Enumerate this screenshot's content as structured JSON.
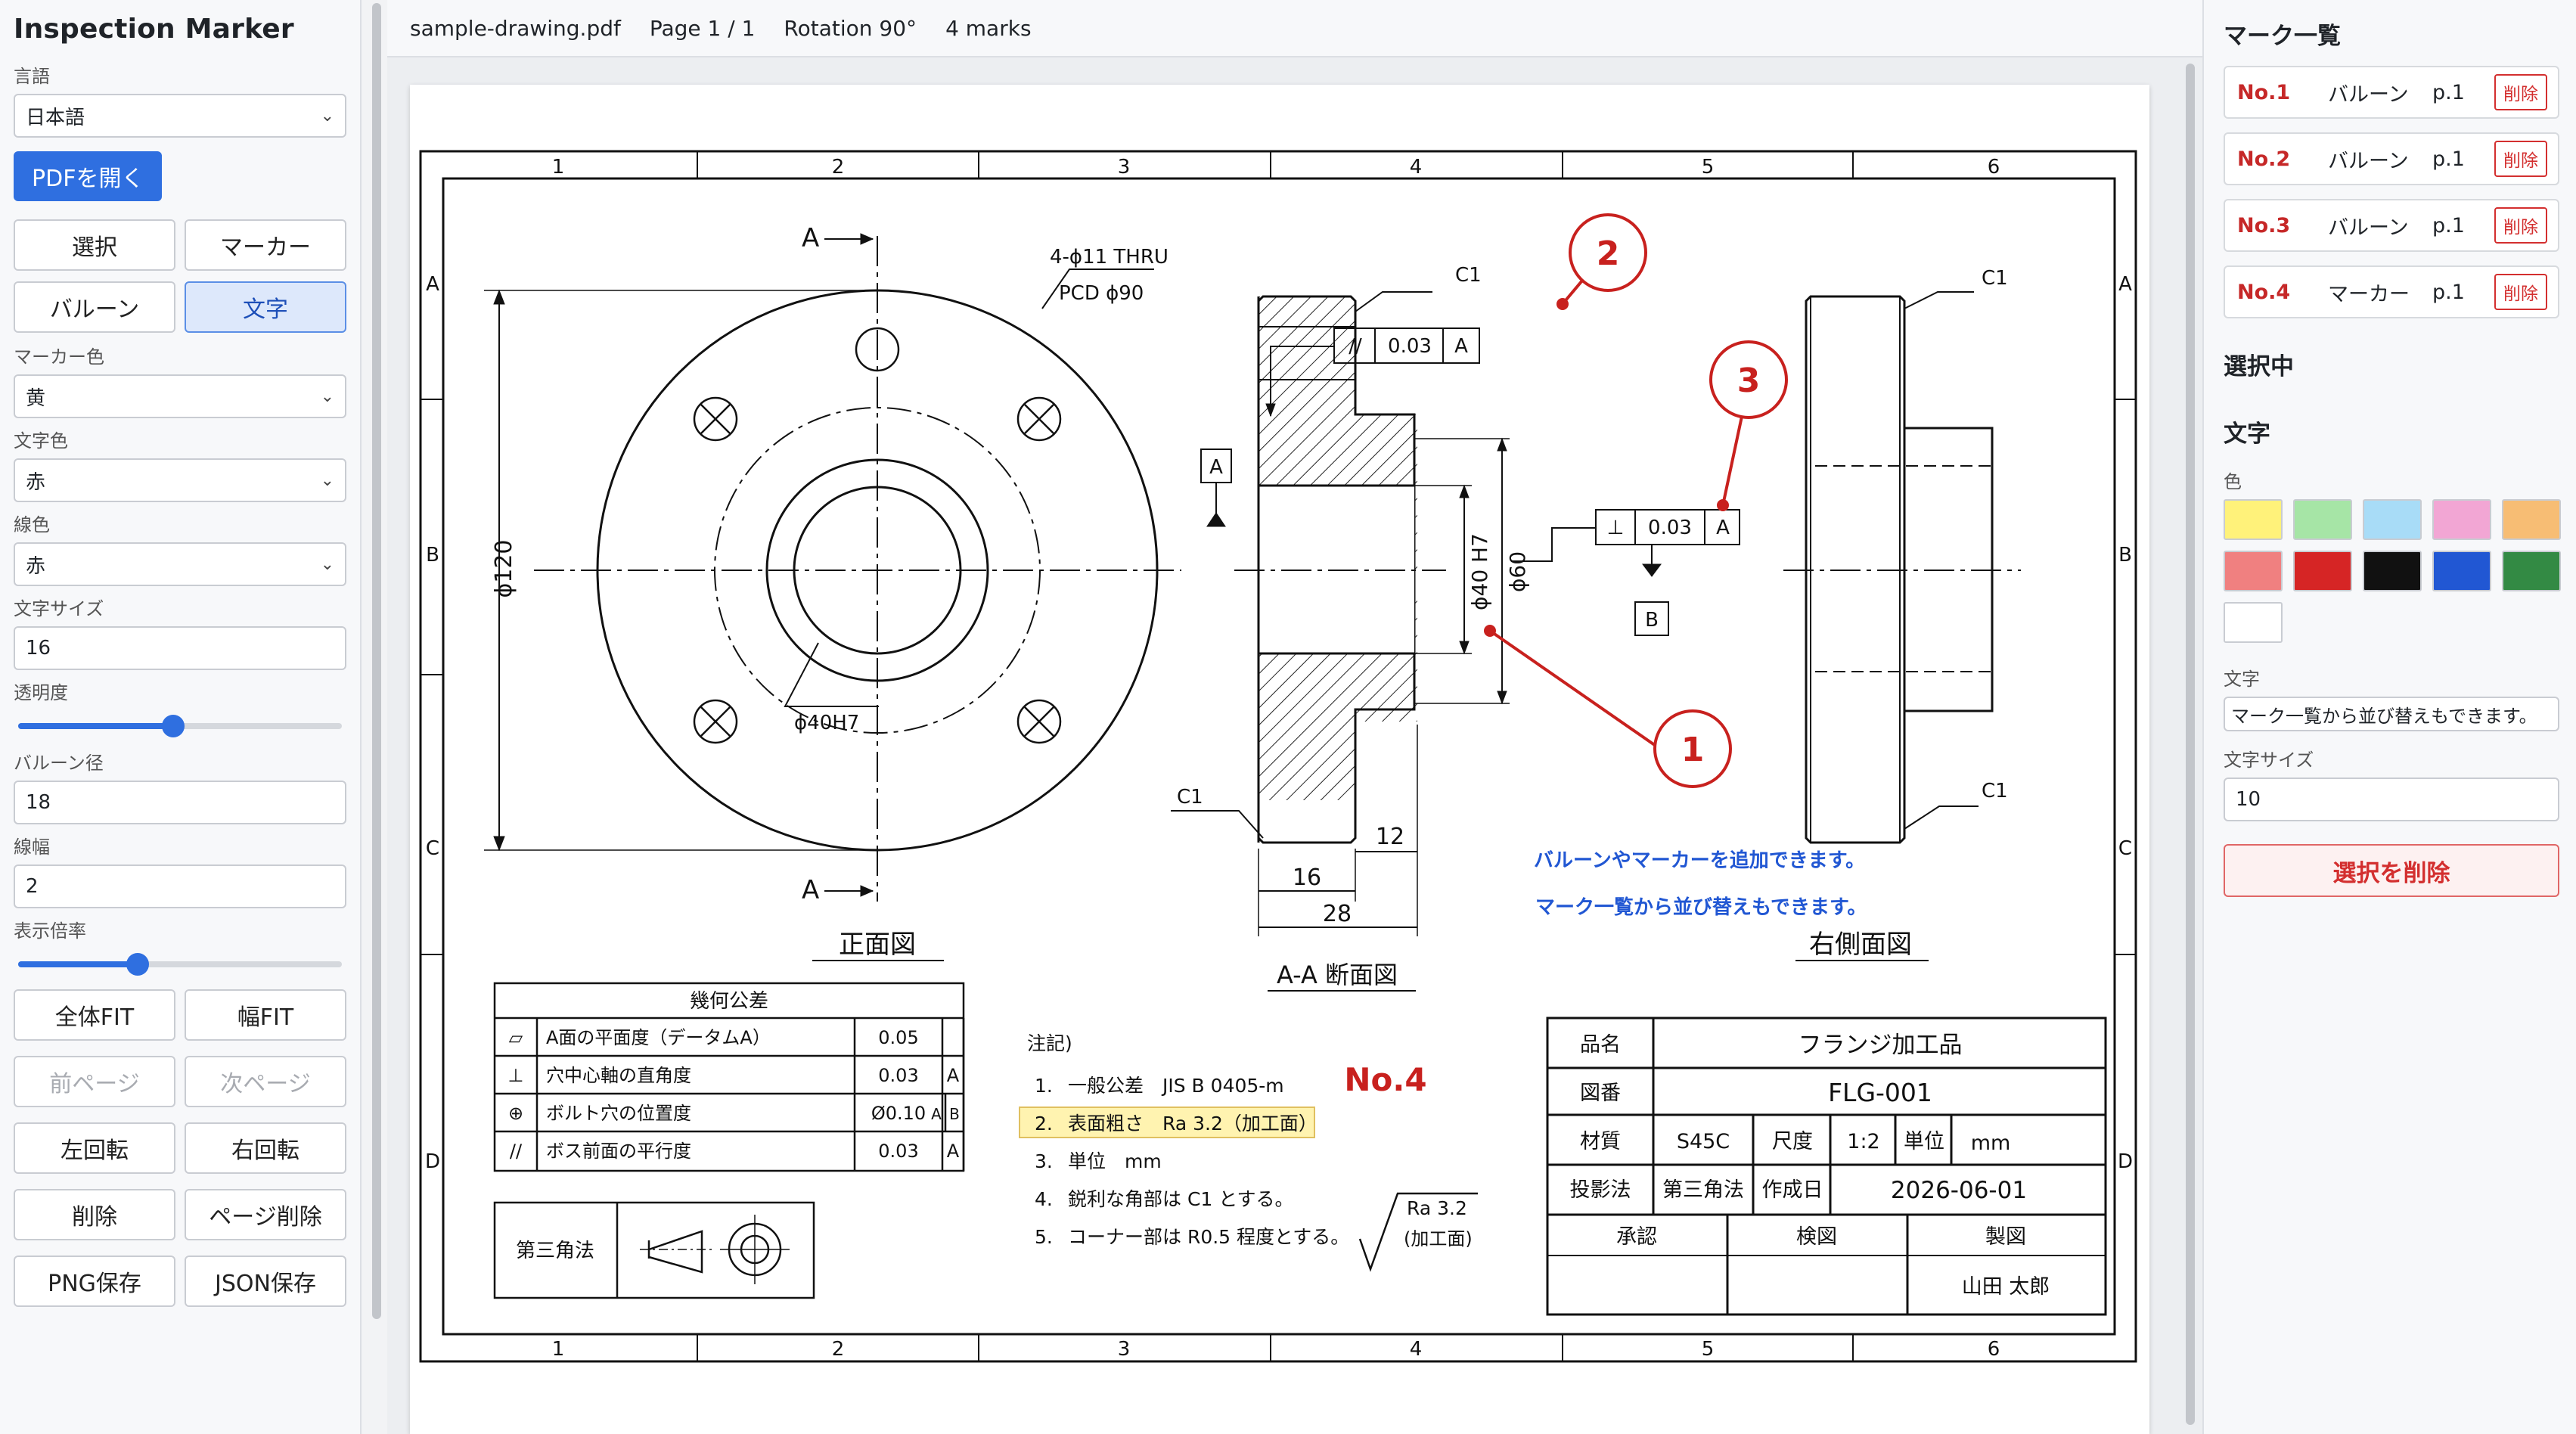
{
  "app": {
    "title": "Inspection Marker"
  },
  "left": {
    "language_label": "言語",
    "language_value": "日本語",
    "open_pdf": "PDFを開く",
    "tools": {
      "select": "選択",
      "marker": "マーカー",
      "balloon": "バルーン",
      "text": "文字"
    },
    "marker_color_label": "マーカー色",
    "marker_color_value": "黄",
    "text_color_label": "文字色",
    "text_color_value": "赤",
    "line_color_label": "線色",
    "line_color_value": "赤",
    "font_size_label": "文字サイズ",
    "font_size_value": "16",
    "opacity_label": "透明度",
    "opacity_fraction": 0.48,
    "balloon_diameter_label": "バルーン径",
    "balloon_diameter_value": "18",
    "line_width_label": "線幅",
    "line_width_value": "2",
    "zoom_label": "表示倍率",
    "zoom_fraction": 0.37,
    "buttons": {
      "fit_all": "全体FIT",
      "fit_width": "幅FIT",
      "prev_page": "前ページ",
      "next_page": "次ページ",
      "rotate_left": "左回転",
      "rotate_right": "右回転",
      "delete": "削除",
      "delete_page": "ページ削除",
      "save_png": "PNG保存",
      "save_json": "JSON保存"
    }
  },
  "topbar": {
    "file": "sample-drawing.pdf",
    "page": "Page 1 / 1",
    "rotation": "Rotation 90°",
    "marks": "4 marks"
  },
  "drawing": {
    "col_labels": [
      "1",
      "2",
      "3",
      "4",
      "5",
      "6"
    ],
    "row_labels": [
      "A",
      "B",
      "C",
      "D"
    ],
    "view_front": "正面図",
    "view_section": "A-A 断面図",
    "view_right": "右側面図",
    "section_marker": "A",
    "hole_note_1": "4-ϕ11 THRU",
    "hole_note_2": "PCD ϕ90",
    "dim_phi120": "ϕ120",
    "dim_phi40h7": "ϕ40H7",
    "dim_phi40h7_v": "ϕ40 H7",
    "dim_phi60": "ϕ60",
    "dim_12": "12",
    "dim_16": "16",
    "dim_28": "28",
    "chamfer": "C1",
    "fcf_parallel": [
      "//",
      "0.03",
      "A"
    ],
    "fcf_perp": [
      "⊥",
      "0.03",
      "A"
    ],
    "datum_a": "A",
    "datum_b": "B",
    "geo_table": {
      "title": "幾何公差",
      "rows": [
        [
          "▱",
          "A面の平面度（データムA）",
          "0.05",
          "",
          ""
        ],
        [
          "⊥",
          "穴中心軸の直角度",
          "0.03",
          "A",
          ""
        ],
        [
          "⊕",
          "ボルト穴の位置度",
          "Ø0.10",
          "A",
          "B"
        ],
        [
          "//",
          "ボス前面の平行度",
          "0.03",
          "A",
          ""
        ]
      ]
    },
    "projection_label": "第三角法",
    "notes": {
      "title": "注記)",
      "items": [
        [
          "1.",
          "一般公差　JIS B 0405-m"
        ],
        [
          "2.",
          "表面粗さ　Ra 3.2（加工面）"
        ],
        [
          "3.",
          "単位　mm"
        ],
        [
          "4.",
          "鋭利な角部は C1 とする。"
        ],
        [
          "5.",
          "コーナー部は R0.5 程度とする。"
        ]
      ],
      "ra_1": "Ra 3.2",
      "ra_2": "(加工面)"
    },
    "title_block": {
      "name_label": "品名",
      "name_value": "フランジ加工品",
      "drawing_no_label": "図番",
      "drawing_no_value": "FLG-001",
      "material_label": "材質",
      "material_value": "S45C",
      "scale_label": "尺度",
      "scale_value": "1:2",
      "unit_label": "単位",
      "unit_value": "mm",
      "projection_label": "投影法",
      "projection_value": "第三角法",
      "date_label": "作成日",
      "date_value": "2026-06-01",
      "approve": "承認",
      "check": "検図",
      "draft": "製図",
      "drafter": "山田 太郎"
    },
    "annotations": {
      "balloon_1": "1",
      "balloon_2": "2",
      "balloon_3": "3",
      "no4": "No.4",
      "text_line_1": "バルーンやマーカーを追加できます。",
      "text_line_2": "マーク一覧から並び替えもできます。"
    }
  },
  "right": {
    "list_title": "マーク一覧",
    "marks": [
      {
        "no": "No.1",
        "type": "バルーン",
        "page": "p.1",
        "delete": "削除"
      },
      {
        "no": "No.2",
        "type": "バルーン",
        "page": "p.1",
        "delete": "削除"
      },
      {
        "no": "No.3",
        "type": "バルーン",
        "page": "p.1",
        "delete": "削除"
      },
      {
        "no": "No.4",
        "type": "マーカー",
        "page": "p.1",
        "delete": "削除"
      }
    ],
    "selected_title": "選択中",
    "text_section": "文字",
    "color_label": "色",
    "swatches": [
      "#fff27a",
      "#a6e5a6",
      "#a8dcf7",
      "#f2a6d4",
      "#f7bd74",
      "#f08080",
      "#d62525",
      "#111111",
      "#2157d3",
      "#338a44",
      "#ffffff"
    ],
    "text_label": "文字",
    "text_value": "マーク一覧から並び替えもできます。",
    "size_label": "文字サイズ",
    "size_value": "10",
    "delete_selected": "選択を削除"
  }
}
